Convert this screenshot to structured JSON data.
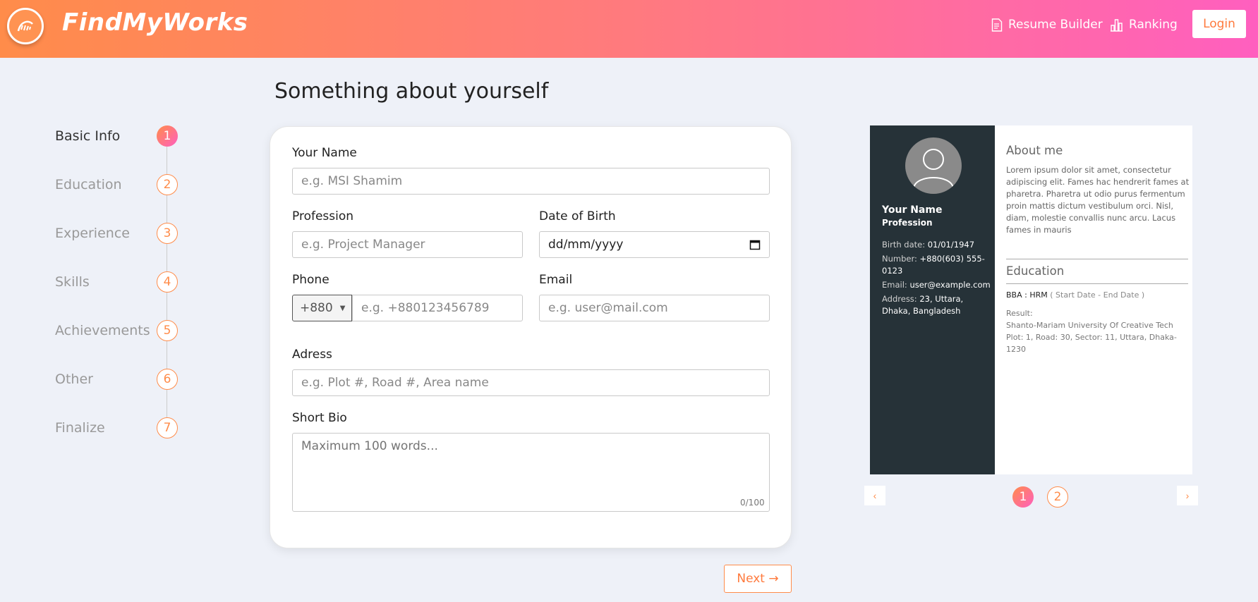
{
  "header": {
    "brand": "FindMyWorks",
    "nav": [
      {
        "label": "Resume Builder",
        "icon": "document-icon"
      },
      {
        "label": "Ranking",
        "icon": "bar-chart-icon"
      }
    ],
    "login_label": "Login",
    "gradient_colors": [
      "#ff8c4a",
      "#ff5fbf"
    ]
  },
  "steps": [
    {
      "label": "Basic Info",
      "num": "1",
      "active": true
    },
    {
      "label": "Education",
      "num": "2"
    },
    {
      "label": "Experience",
      "num": "3"
    },
    {
      "label": "Skills",
      "num": "4"
    },
    {
      "label": "Achievements",
      "num": "5"
    },
    {
      "label": "Other",
      "num": "6"
    },
    {
      "label": "Finalize",
      "num": "7"
    }
  ],
  "page_title": "Something about yourself",
  "form": {
    "name_label": "Your Name",
    "name_placeholder": "e.g. MSI Shamim",
    "profession_label": "Profession",
    "profession_placeholder": "e.g. Project Manager",
    "dob_label": "Date of Birth",
    "dob_value": "dd/mm/yyyy",
    "phone_label": "Phone",
    "phone_code": "+880",
    "phone_placeholder": "e.g. +880123456789",
    "email_label": "Email",
    "email_placeholder": "e.g. user@mail.com",
    "address_label": "Adress",
    "address_placeholder": "e.g. Plot #, Road #, Area name",
    "bio_label": "Short Bio",
    "bio_placeholder": "Maximum 100 words...",
    "bio_counter": "0/100"
  },
  "next_label": "Next →",
  "preview": {
    "name": "Your Name",
    "profession": "Profession",
    "birth_label": "Birth date: ",
    "birth_value": "01/01/1947",
    "number_label": "Number: ",
    "number_value": "+880(603) 555-0123",
    "email_label": "Email: ",
    "email_value": "user@example.com",
    "address_label": "Address: ",
    "address_value": "23, Uttara, Dhaka, Bangladesh",
    "about_heading": "About me",
    "about_text": "Lorem ipsum dolor sit amet, consectetur adipiscing elit. Fames hac hendrerit fames at pharetra. Pharetra ut odio purus fermentum proin mattis dictum vestibulum orci. Nisl, diam, molestie convallis nunc arcu. Lacus fames in mauris",
    "education_heading": "Education",
    "degree": "BBA : HRM",
    "date_range": "( Start Date - End Date )",
    "result_label": "Result:",
    "institution": "Shanto-Mariam University Of Creative Tech",
    "institution_address": "Plot: 1, Road: 30, Sector: 11, Uttara, Dhaka-1230"
  },
  "pagination": {
    "prev": "‹",
    "pages": [
      "1",
      "2"
    ],
    "next": "›"
  }
}
